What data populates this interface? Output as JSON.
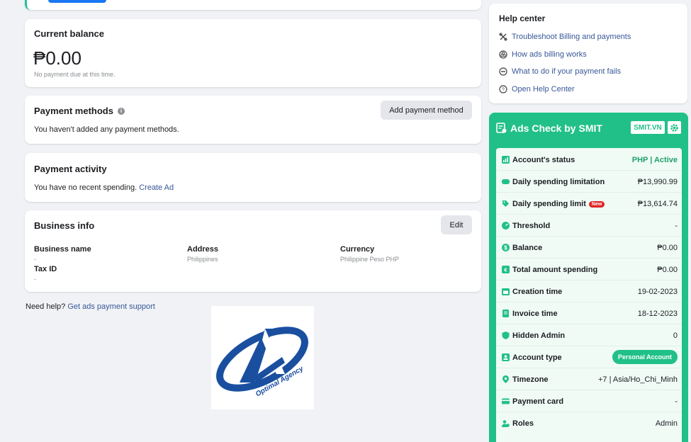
{
  "balance": {
    "title": "Current balance",
    "amount": "₱0.00",
    "note": "No payment due at this time."
  },
  "payment_methods": {
    "title": "Payment methods",
    "empty_text": "You haven't added any payment methods.",
    "add_button": "Add payment method"
  },
  "payment_activity": {
    "title": "Payment activity",
    "text": "You have no recent spending.",
    "link": "Create Ad"
  },
  "business_info": {
    "title": "Business info",
    "edit_button": "Edit",
    "fields": {
      "business_name_label": "Business name",
      "business_name_value": "-",
      "address_label": "Address",
      "address_value": "Philippines",
      "currency_label": "Currency",
      "currency_value": "Philippine Peso PHP",
      "tax_id_label": "Tax ID",
      "tax_id_value": "-"
    }
  },
  "need_help": {
    "text": "Need help?",
    "link": "Get ads payment support"
  },
  "help_center": {
    "title": "Help center",
    "items": [
      {
        "label": "Troubleshoot Billing and payments",
        "icon": "tools-icon"
      },
      {
        "label": "How ads billing works",
        "icon": "coins-icon"
      },
      {
        "label": "What to do if your payment fails",
        "icon": "minus-circle-icon"
      },
      {
        "label": "Open Help Center",
        "icon": "question-circle-icon"
      }
    ]
  },
  "smit": {
    "title": "Ads Check by SMIT",
    "badge": "SMIT.VN",
    "accent": "#21c089",
    "rows": [
      {
        "label": "Account's status",
        "value": "PHP | Active",
        "icon": "chart-icon"
      },
      {
        "label": "Daily spending limitation",
        "value": "₱13,990.99",
        "icon": "card-icon"
      },
      {
        "label": "Daily spending limit",
        "badge": "New",
        "value": "₱13,614.74",
        "icon": "tag-icon"
      },
      {
        "label": "Threshold",
        "value": "-",
        "icon": "gauge-icon"
      },
      {
        "label": "Balance",
        "value": "₱0.00",
        "icon": "dollar-icon"
      },
      {
        "label": "Total amount spending",
        "value": "₱0.00",
        "icon": "receipt-icon"
      },
      {
        "label": "Creation time",
        "value": "19-02-2023",
        "icon": "calendar-icon"
      },
      {
        "label": "Invoice time",
        "value": "18-12-2023",
        "icon": "invoice-icon"
      },
      {
        "label": "Hidden Admin",
        "value": "0",
        "icon": "shield-icon"
      },
      {
        "label": "Account type",
        "value": "Personal Account",
        "icon": "id-card-icon"
      },
      {
        "label": "Timezone",
        "value": "+7 | Asia/Ho_Chi_Minh",
        "icon": "location-icon"
      },
      {
        "label": "Payment card",
        "value": "-",
        "icon": "credit-card-icon"
      },
      {
        "label": "Roles",
        "value": "Admin",
        "icon": "users-icon"
      }
    ]
  },
  "logo": {
    "text": "Optimal Agency"
  }
}
